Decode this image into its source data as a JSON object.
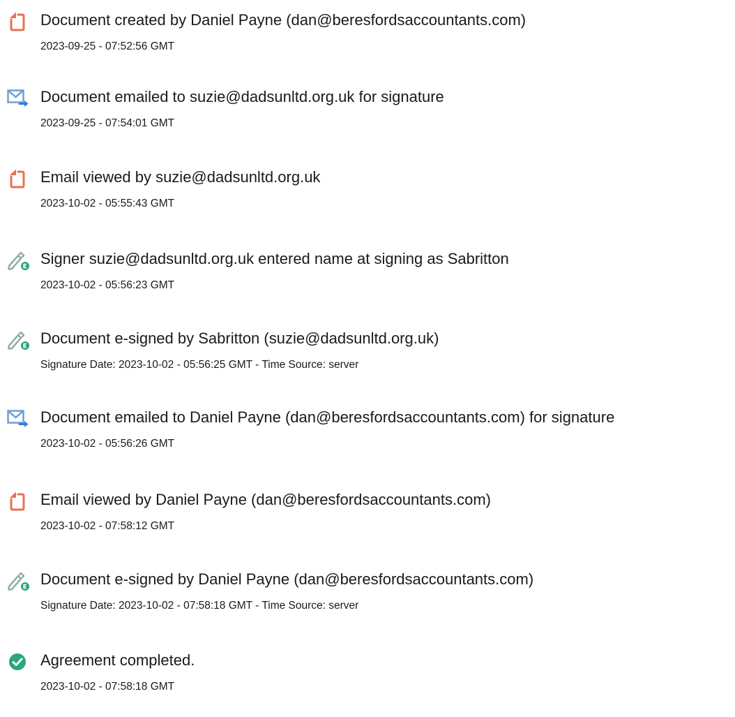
{
  "colors": {
    "document_icon": "#E8704F",
    "email_icon": "#6AA1D8",
    "email_arrow": "#2F7FD0",
    "pen_icon": "#8FB0A6",
    "pen_badge": "#2BA57B",
    "check_icon": "#2BA57B"
  },
  "events": [
    {
      "icon": "document-icon",
      "title": "Document created by Daniel Payne (dan@beresfordsaccountants.com)",
      "date": "2023-09-25 - 07:52:56 GMT"
    },
    {
      "icon": "email-sent-icon",
      "title": "Document emailed to suzie@dadsunltd.org.uk for signature",
      "date": "2023-09-25 - 07:54:01 GMT"
    },
    {
      "icon": "document-icon",
      "title": "Email viewed by suzie@dadsunltd.org.uk",
      "date": "2023-10-02 - 05:55:43 GMT"
    },
    {
      "icon": "e-sign-pen-icon",
      "title": "Signer suzie@dadsunltd.org.uk entered name at signing as Sabritton",
      "date": "2023-10-02 - 05:56:23 GMT"
    },
    {
      "icon": "e-sign-pen-icon",
      "title": "Document e-signed by Sabritton (suzie@dadsunltd.org.uk)",
      "date": "Signature Date: 2023-10-02 - 05:56:25 GMT - Time Source: server"
    },
    {
      "icon": "email-sent-icon",
      "title": "Document emailed to Daniel Payne (dan@beresfordsaccountants.com) for signature",
      "date": "2023-10-02 - 05:56:26 GMT"
    },
    {
      "icon": "document-icon",
      "title": "Email viewed by Daniel Payne (dan@beresfordsaccountants.com)",
      "date": "2023-10-02 - 07:58:12 GMT"
    },
    {
      "icon": "e-sign-pen-icon",
      "title": "Document e-signed by Daniel Payne (dan@beresfordsaccountants.com)",
      "date": "Signature Date: 2023-10-02 - 07:58:18 GMT - Time Source: server"
    },
    {
      "icon": "check-circle-icon",
      "title": "Agreement completed.",
      "date": "2023-10-02 - 07:58:18 GMT"
    }
  ]
}
